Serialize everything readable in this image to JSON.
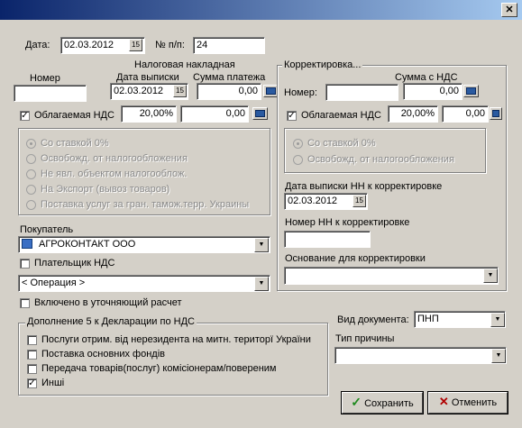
{
  "window": {
    "close_glyph": "✕"
  },
  "header": {
    "date_label": "Дата:",
    "date_value": "02.03.2012",
    "num_label": "№ п/п:",
    "num_value": "24"
  },
  "invoice": {
    "group_title": "Налоговая накладная",
    "number_label": "Номер",
    "number_value": "",
    "issue_date_label": "Дата выписки",
    "issue_date_value": "02.03.2012",
    "payment_sum_label": "Сумма платежа",
    "payment_sum_value": "0,00",
    "vat_checkbox_label": "Облагаемая НДС",
    "vat_rate": "20,00%",
    "vat_amount": "0,00"
  },
  "rates": {
    "options": [
      "Со ставкой 0%",
      "Освобожд. от налогообложения",
      "Не явл. объектом налогооблож.",
      "На Экспорт (вывоз товаров)",
      "Поставка услуг за гран. тамож.терр. Украины"
    ]
  },
  "correction": {
    "group_title": "Корректировка...",
    "sum_vat_label": "Сумма с НДС",
    "number_label": "Номер:",
    "number_value": "",
    "sum_vat_value": "0,00",
    "vat_checkbox_label": "Облагаемая НДС",
    "vat_rate": "20,00%",
    "vat_amount": "0,00",
    "rate_options": [
      "Со ставкой 0%",
      "Освобожд. от налогообложения"
    ],
    "date_label": "Дата выписки НН к корректировке",
    "date_value": "02.03.2012",
    "nn_number_label": "Номер НН к корректировке",
    "nn_number_value": "",
    "basis_label": "Основание для корректировки",
    "basis_value": ""
  },
  "buyer": {
    "label": "Покупатель",
    "value": "АГРОКОНТАКТ ООО",
    "vat_payer_label": "Плательщик НДС",
    "operation_value": "< Операция >",
    "included_label": "Включено в уточняющий расчет"
  },
  "supplement": {
    "title": "Дополнение 5 к Декларации по НДС",
    "items": [
      {
        "label": "Послуги отрим. від нерезидента на митн. територї України",
        "checked": false
      },
      {
        "label": "Поставка основних фондів",
        "checked": false
      },
      {
        "label": "Передача товарів(послуг) комісіонерам/повереним",
        "checked": false
      },
      {
        "label": "Инші",
        "checked": true
      }
    ]
  },
  "doc": {
    "type_label": "Вид документа:",
    "type_value": "ПНП",
    "reason_label": "Тип причины",
    "reason_value": ""
  },
  "actions": {
    "save_label": "Сохранить",
    "cancel_label": "Отменить"
  },
  "icons": {
    "checkmark": "✓",
    "save": "check-icon",
    "cancel": "x-icon",
    "calendar": "calendar-icon",
    "calculator": "calculator-icon",
    "dropdown": "chevron-down-icon",
    "company": "building-icon"
  },
  "colors": {
    "titlebar": "#0a246a",
    "save_check": "#1f8a1f",
    "cancel_x": "#b00000",
    "face": "#d4d0c8"
  }
}
